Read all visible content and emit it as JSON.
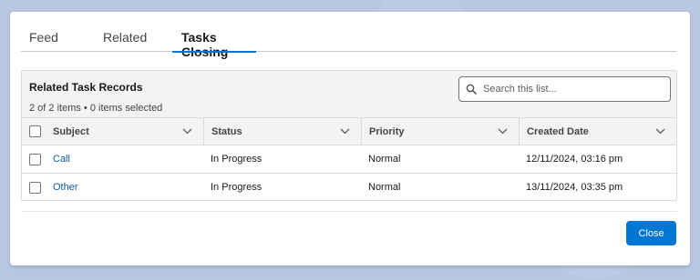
{
  "tabs": [
    {
      "label": "Feed",
      "active": false
    },
    {
      "label": "Related",
      "active": false
    },
    {
      "label": "Tasks Closing",
      "active": true
    }
  ],
  "card": {
    "title": "Related Task Records",
    "meta": "2 of 2 items • 0 items selected",
    "search_placeholder": "Search this list..."
  },
  "table": {
    "columns": [
      "Subject",
      "Status",
      "Priority",
      "Created Date"
    ],
    "rows": [
      {
        "subject": "Call",
        "status": "In Progress",
        "priority": "Normal",
        "created": "12/11/2024, 03:16 pm"
      },
      {
        "subject": "Other",
        "status": "In Progress",
        "priority": "Normal",
        "created": "13/11/2024, 03:35 pm"
      }
    ]
  },
  "footer": {
    "close_label": "Close"
  },
  "colors": {
    "accent": "#0176d3",
    "link": "#0b5cab",
    "backdrop": "#b7c7e3"
  },
  "icons": {
    "search": "search-icon",
    "sort": "chevron-down-icon"
  }
}
